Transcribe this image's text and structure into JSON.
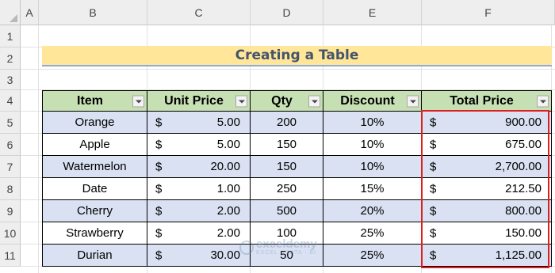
{
  "sheet": {
    "columns": [
      "A",
      "B",
      "C",
      "D",
      "E",
      "F"
    ],
    "rows": [
      "1",
      "2",
      "3",
      "4",
      "5",
      "6",
      "7",
      "8",
      "9",
      "10",
      "11"
    ]
  },
  "title": "Creating a Table",
  "table": {
    "headers": [
      "Item",
      "Unit Price",
      "Qty",
      "Discount",
      "Total Price"
    ],
    "currency_symbol": "$",
    "rows": [
      {
        "item": "Orange",
        "unit_price": "5.00",
        "qty": "200",
        "discount": "10%",
        "total_price": "900.00"
      },
      {
        "item": "Apple",
        "unit_price": "5.00",
        "qty": "150",
        "discount": "10%",
        "total_price": "675.00"
      },
      {
        "item": "Watermelon",
        "unit_price": "20.00",
        "qty": "150",
        "discount": "10%",
        "total_price": "2,700.00"
      },
      {
        "item": "Date",
        "unit_price": "1.00",
        "qty": "250",
        "discount": "15%",
        "total_price": "212.50"
      },
      {
        "item": "Cherry",
        "unit_price": "2.00",
        "qty": "500",
        "discount": "20%",
        "total_price": "800.00"
      },
      {
        "item": "Strawberry",
        "unit_price": "2.00",
        "qty": "100",
        "discount": "25%",
        "total_price": "150.00"
      },
      {
        "item": "Durian",
        "unit_price": "30.00",
        "qty": "50",
        "discount": "25%",
        "total_price": "1,125.00"
      }
    ]
  },
  "watermark": {
    "name": "exceldemy",
    "tagline": "EXCEL · DATA · BI"
  },
  "colors": {
    "title_fill": "#ffe699",
    "title_text": "#44546a",
    "header_fill": "#c6e0b4",
    "band_fill": "#d9e1f2",
    "highlight_border": "#e01e1e"
  }
}
